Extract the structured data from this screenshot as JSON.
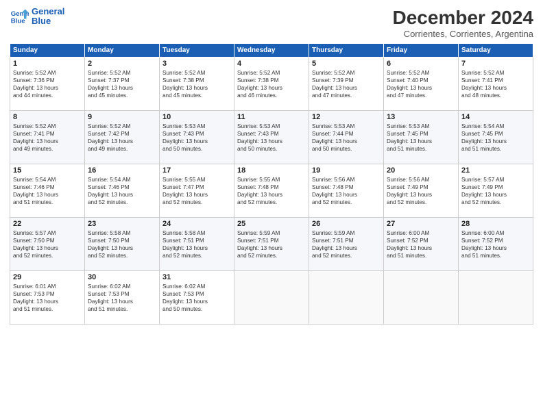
{
  "logo": {
    "line1": "General",
    "line2": "Blue"
  },
  "header": {
    "title": "December 2024",
    "subtitle": "Corrientes, Corrientes, Argentina"
  },
  "weekdays": [
    "Sunday",
    "Monday",
    "Tuesday",
    "Wednesday",
    "Thursday",
    "Friday",
    "Saturday"
  ],
  "weeks": [
    [
      {
        "day": 1,
        "info": "Sunrise: 5:52 AM\nSunset: 7:36 PM\nDaylight: 13 hours\nand 44 minutes."
      },
      {
        "day": 2,
        "info": "Sunrise: 5:52 AM\nSunset: 7:37 PM\nDaylight: 13 hours\nand 45 minutes."
      },
      {
        "day": 3,
        "info": "Sunrise: 5:52 AM\nSunset: 7:38 PM\nDaylight: 13 hours\nand 45 minutes."
      },
      {
        "day": 4,
        "info": "Sunrise: 5:52 AM\nSunset: 7:38 PM\nDaylight: 13 hours\nand 46 minutes."
      },
      {
        "day": 5,
        "info": "Sunrise: 5:52 AM\nSunset: 7:39 PM\nDaylight: 13 hours\nand 47 minutes."
      },
      {
        "day": 6,
        "info": "Sunrise: 5:52 AM\nSunset: 7:40 PM\nDaylight: 13 hours\nand 47 minutes."
      },
      {
        "day": 7,
        "info": "Sunrise: 5:52 AM\nSunset: 7:41 PM\nDaylight: 13 hours\nand 48 minutes."
      }
    ],
    [
      {
        "day": 8,
        "info": "Sunrise: 5:52 AM\nSunset: 7:41 PM\nDaylight: 13 hours\nand 49 minutes."
      },
      {
        "day": 9,
        "info": "Sunrise: 5:52 AM\nSunset: 7:42 PM\nDaylight: 13 hours\nand 49 minutes."
      },
      {
        "day": 10,
        "info": "Sunrise: 5:53 AM\nSunset: 7:43 PM\nDaylight: 13 hours\nand 50 minutes."
      },
      {
        "day": 11,
        "info": "Sunrise: 5:53 AM\nSunset: 7:43 PM\nDaylight: 13 hours\nand 50 minutes."
      },
      {
        "day": 12,
        "info": "Sunrise: 5:53 AM\nSunset: 7:44 PM\nDaylight: 13 hours\nand 50 minutes."
      },
      {
        "day": 13,
        "info": "Sunrise: 5:53 AM\nSunset: 7:45 PM\nDaylight: 13 hours\nand 51 minutes."
      },
      {
        "day": 14,
        "info": "Sunrise: 5:54 AM\nSunset: 7:45 PM\nDaylight: 13 hours\nand 51 minutes."
      }
    ],
    [
      {
        "day": 15,
        "info": "Sunrise: 5:54 AM\nSunset: 7:46 PM\nDaylight: 13 hours\nand 51 minutes."
      },
      {
        "day": 16,
        "info": "Sunrise: 5:54 AM\nSunset: 7:46 PM\nDaylight: 13 hours\nand 52 minutes."
      },
      {
        "day": 17,
        "info": "Sunrise: 5:55 AM\nSunset: 7:47 PM\nDaylight: 13 hours\nand 52 minutes."
      },
      {
        "day": 18,
        "info": "Sunrise: 5:55 AM\nSunset: 7:48 PM\nDaylight: 13 hours\nand 52 minutes."
      },
      {
        "day": 19,
        "info": "Sunrise: 5:56 AM\nSunset: 7:48 PM\nDaylight: 13 hours\nand 52 minutes."
      },
      {
        "day": 20,
        "info": "Sunrise: 5:56 AM\nSunset: 7:49 PM\nDaylight: 13 hours\nand 52 minutes."
      },
      {
        "day": 21,
        "info": "Sunrise: 5:57 AM\nSunset: 7:49 PM\nDaylight: 13 hours\nand 52 minutes."
      }
    ],
    [
      {
        "day": 22,
        "info": "Sunrise: 5:57 AM\nSunset: 7:50 PM\nDaylight: 13 hours\nand 52 minutes."
      },
      {
        "day": 23,
        "info": "Sunrise: 5:58 AM\nSunset: 7:50 PM\nDaylight: 13 hours\nand 52 minutes."
      },
      {
        "day": 24,
        "info": "Sunrise: 5:58 AM\nSunset: 7:51 PM\nDaylight: 13 hours\nand 52 minutes."
      },
      {
        "day": 25,
        "info": "Sunrise: 5:59 AM\nSunset: 7:51 PM\nDaylight: 13 hours\nand 52 minutes."
      },
      {
        "day": 26,
        "info": "Sunrise: 5:59 AM\nSunset: 7:51 PM\nDaylight: 13 hours\nand 52 minutes."
      },
      {
        "day": 27,
        "info": "Sunrise: 6:00 AM\nSunset: 7:52 PM\nDaylight: 13 hours\nand 51 minutes."
      },
      {
        "day": 28,
        "info": "Sunrise: 6:00 AM\nSunset: 7:52 PM\nDaylight: 13 hours\nand 51 minutes."
      }
    ],
    [
      {
        "day": 29,
        "info": "Sunrise: 6:01 AM\nSunset: 7:53 PM\nDaylight: 13 hours\nand 51 minutes."
      },
      {
        "day": 30,
        "info": "Sunrise: 6:02 AM\nSunset: 7:53 PM\nDaylight: 13 hours\nand 51 minutes."
      },
      {
        "day": 31,
        "info": "Sunrise: 6:02 AM\nSunset: 7:53 PM\nDaylight: 13 hours\nand 50 minutes."
      },
      null,
      null,
      null,
      null
    ]
  ]
}
